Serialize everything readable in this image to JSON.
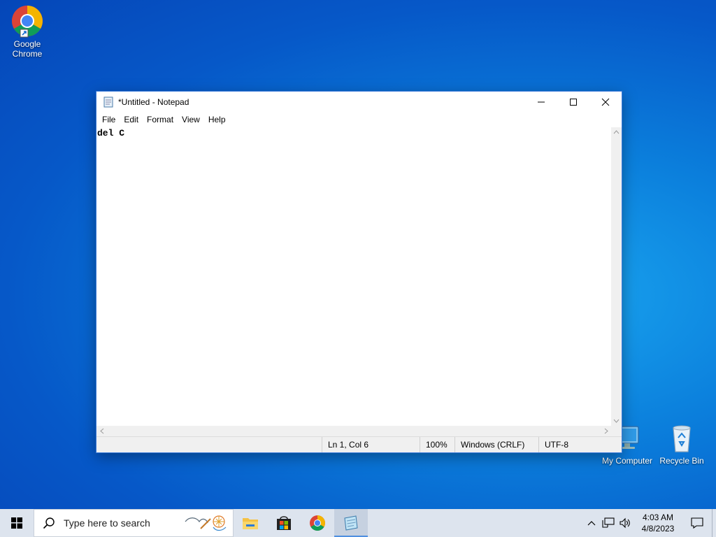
{
  "desktop": {
    "icons": [
      {
        "label_line1": "Google",
        "label_line2": "Chrome"
      },
      {
        "label": "My Computer"
      },
      {
        "label": "Recycle Bin"
      }
    ]
  },
  "notepad": {
    "title": "*Untitled - Notepad",
    "menu": [
      "File",
      "Edit",
      "Format",
      "View",
      "Help"
    ],
    "content": "del C",
    "status": {
      "position": "Ln 1, Col 6",
      "zoom": "100%",
      "line_ending": "Windows (CRLF)",
      "encoding": "UTF-8"
    }
  },
  "taskbar": {
    "search_placeholder": "Type here to search",
    "clock_time": "4:03 AM",
    "clock_date": "4/8/2023"
  },
  "colors": {
    "accent": "#4f8fe0",
    "taskbar": "#dde4ee",
    "window_border": "#3b7ad8"
  }
}
